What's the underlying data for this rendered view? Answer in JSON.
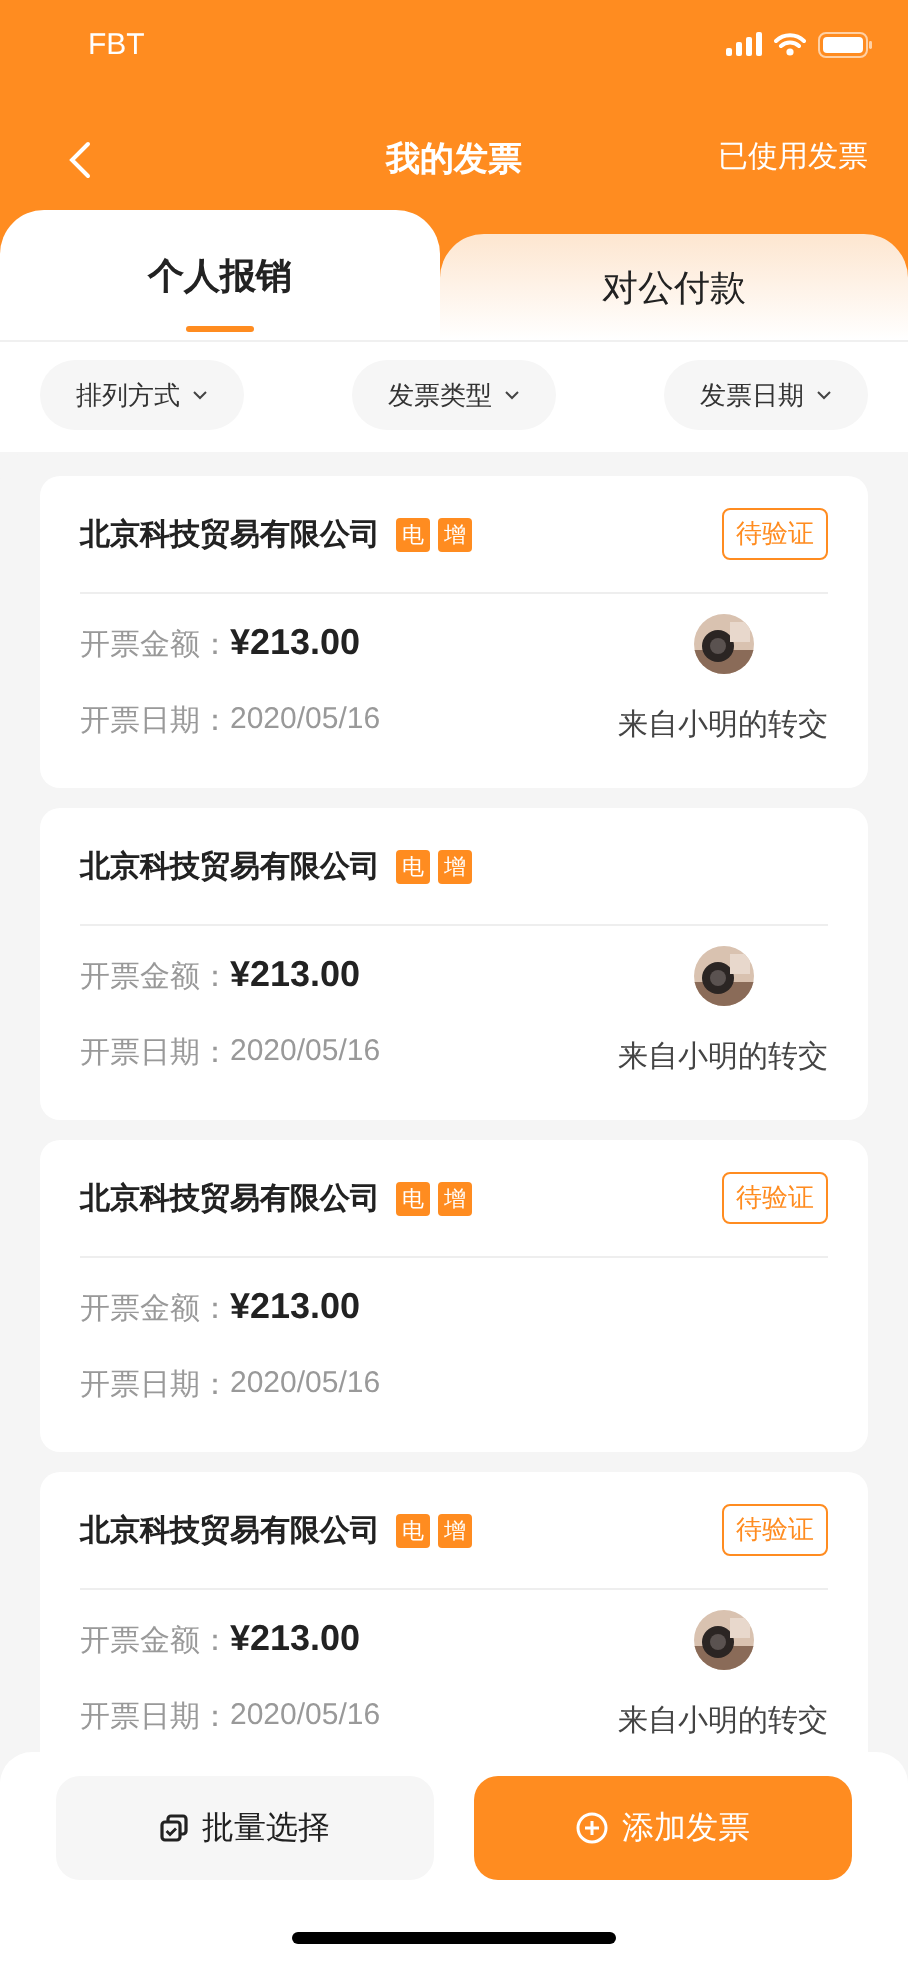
{
  "status_bar": {
    "carrier": "FBT"
  },
  "nav": {
    "title": "我的发票",
    "action": "已使用发票"
  },
  "tabs": [
    {
      "label": "个人报销",
      "selected": true
    },
    {
      "label": "对公付款",
      "selected": false
    }
  ],
  "filters": [
    "排列方式",
    "发票类型",
    "发票日期"
  ],
  "invoices": [
    {
      "company": "北京科技贸易有限公司",
      "tags": [
        "电",
        "增"
      ],
      "status": "待验证",
      "amount_label": "开票金额：",
      "amount": "¥213.00",
      "date_label": "开票日期：",
      "date": "2020/05/16",
      "transfer": "来自小明的转交"
    },
    {
      "company": "北京科技贸易有限公司",
      "tags": [
        "电",
        "增"
      ],
      "amount_label": "开票金额：",
      "amount": "¥213.00",
      "date_label": "开票日期：",
      "date": "2020/05/16",
      "transfer": "来自小明的转交"
    },
    {
      "company": "北京科技贸易有限公司",
      "tags": [
        "电",
        "增"
      ],
      "status": "待验证",
      "amount_label": "开票金额：",
      "amount": "¥213.00",
      "date_label": "开票日期：",
      "date": "2020/05/16"
    },
    {
      "company": "北京科技贸易有限公司",
      "tags": [
        "电",
        "增"
      ],
      "status": "待验证",
      "amount_label": "开票金额：",
      "amount": "¥213.00",
      "date_label": "开票日期：",
      "date": "2020/05/16",
      "transfer": "来自小明的转交"
    }
  ],
  "bottom_buttons": [
    {
      "label": "批量选择",
      "kind": "secondary"
    },
    {
      "label": "添加发票",
      "kind": "primary"
    }
  ]
}
